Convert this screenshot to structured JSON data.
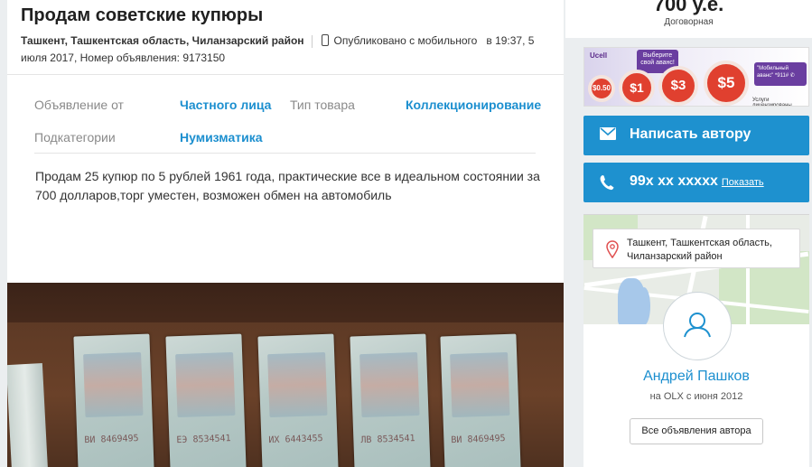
{
  "listing": {
    "title": "Продам советские купюры",
    "location": "Ташкент, Ташкентская область, Чиланзарский район",
    "published_mobile": "Опубликовано с мобильного",
    "published_time": "в 19:37, 5",
    "published_date_line2": "июля 2017, Номер объявления: 9173150",
    "params": [
      {
        "label": "Объявление от",
        "value": "Частного лица"
      },
      {
        "label": "Тип товара",
        "value": "Коллекционирование"
      },
      {
        "label": "Подкатегории",
        "value": "Нумизматика"
      }
    ],
    "description": "Продам 25 купюр по 5 рублей 1961 года, практические все в идеальном состоянии за 700 долларов,торг уместен, возможен обмен на автомобиль"
  },
  "sidebar": {
    "price": "700 у.е.",
    "price_note": "Договорная",
    "ad": {
      "brand": "Ucell",
      "pill": "Выберите свой аванс!",
      "amounts": [
        "$0.50",
        "$1",
        "$3",
        "$5"
      ],
      "right_text": "\"Мобильный аванс\" *911# ✆",
      "footer": "Услуги лицензированы"
    },
    "write_author": "Написать автору",
    "phone_masked": "99x xx xxxxx",
    "phone_show": "Показать",
    "map_location": "Ташкент, Ташкентская область, Чиланзарский район",
    "seller_name": "Андрей Пашков",
    "seller_since": "на OLX с июня 2012",
    "all_ads": "Все объявления автора"
  },
  "colors": {
    "accent": "#1e91cf",
    "link": "#1c8fcf",
    "background": "#ebeef0"
  }
}
